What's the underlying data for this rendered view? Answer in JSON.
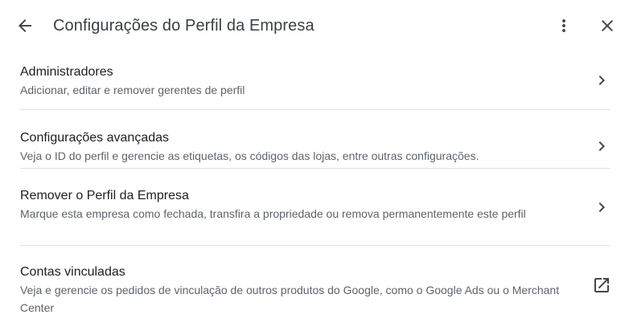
{
  "header": {
    "title": "Configurações do Perfil da Empresa",
    "back_icon": "arrow-back-icon",
    "more_icon": "more-vert-icon",
    "close_icon": "close-icon"
  },
  "items": [
    {
      "title": "Administradores",
      "description": "Adicionar, editar e remover gerentes de perfil",
      "icon": "chevron-right-icon"
    },
    {
      "title": "Configurações avançadas",
      "description": "Veja o ID do perfil e gerencie as etiquetas, os códigos das lojas, entre outras configurações.",
      "icon": "chevron-right-icon"
    },
    {
      "title": "Remover o Perfil da Empresa",
      "description": "Marque esta empresa como fechada, transfira a propriedade ou remova permanentemente este perfil",
      "icon": "chevron-right-icon"
    },
    {
      "title": "Contas vinculadas",
      "description": "Veja e gerencie os pedidos de vinculação de outros produtos do Google, como o Google Ads ou o Merchant Center",
      "icon": "open-in-new-icon"
    }
  ],
  "colors": {
    "text_primary": "#202124",
    "text_secondary": "#5f6368",
    "icon": "#444746",
    "divider": "#e0e0e0"
  }
}
